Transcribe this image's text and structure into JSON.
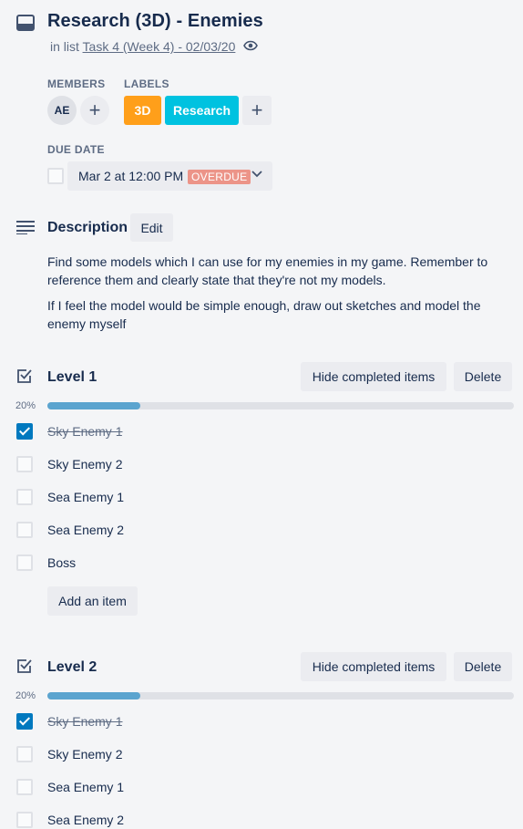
{
  "card": {
    "title": "Research (3D) - Enemies",
    "in_list_prefix": "in list",
    "list_name": "Task 4 (Week 4) - 02/03/20"
  },
  "members": {
    "label": "MEMBERS",
    "initials": "AE",
    "add": "+"
  },
  "labels": {
    "label": "LABELS",
    "items": [
      {
        "text": "3D",
        "color": "#ff9f1a"
      },
      {
        "text": "Research",
        "color": "#00c2e0"
      }
    ],
    "add": "+"
  },
  "due_date": {
    "label": "DUE DATE",
    "value": "Mar 2 at 12:00 PM",
    "status": "OVERDUE",
    "status_color": "#ec9488"
  },
  "description": {
    "heading": "Description",
    "edit_label": "Edit",
    "paragraphs": [
      "Find some models which I can use for my enemies in my game. Remember to reference them and clearly state that they're not my models.",
      "If I feel the model would be simple enough, draw out sketches and model the enemy myself"
    ]
  },
  "checklists": [
    {
      "title": "Level 1",
      "hide_label": "Hide completed items",
      "delete_label": "Delete",
      "progress_label": "20%",
      "progress": 0.2,
      "items": [
        {
          "text": "Sky Enemy 1",
          "done": true
        },
        {
          "text": "Sky Enemy 2",
          "done": false
        },
        {
          "text": "Sea Enemy 1",
          "done": false
        },
        {
          "text": "Sea Enemy 2",
          "done": false
        },
        {
          "text": "Boss",
          "done": false
        }
      ],
      "add_item_label": "Add an item"
    },
    {
      "title": "Level 2",
      "hide_label": "Hide completed items",
      "delete_label": "Delete",
      "progress_label": "20%",
      "progress": 0.2,
      "items": [
        {
          "text": "Sky Enemy 1",
          "done": true
        },
        {
          "text": "Sky Enemy 2",
          "done": false
        },
        {
          "text": "Sea Enemy 1",
          "done": false
        },
        {
          "text": "Sea Enemy 2",
          "done": false
        }
      ]
    }
  ],
  "colors": {
    "accent": "#0079bf",
    "progress": "#5ba4cf",
    "text": "#172b4d",
    "muted": "#5e6c84"
  }
}
